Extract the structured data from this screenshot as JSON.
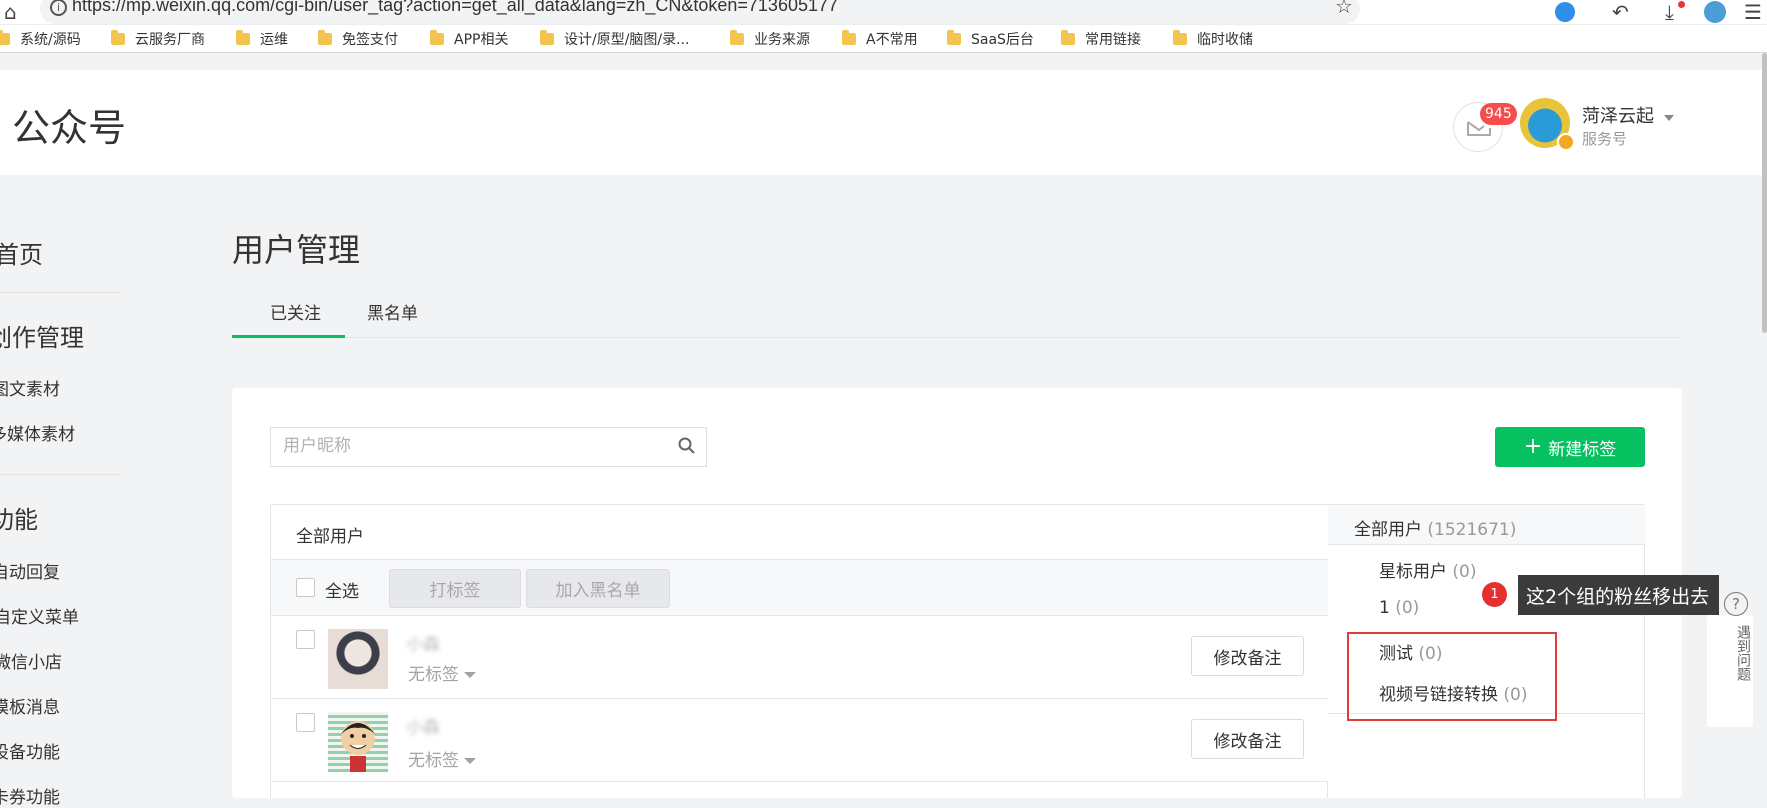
{
  "browser": {
    "url": "https://mp.weixin.qq.com/cgi-bin/user_tag?action=get_all_data&lang=zh_CN&token=713605177",
    "bookmarks": [
      "系统/源码",
      "云服务厂商",
      "运维",
      "免签支付",
      "APP相关",
      "设计/原型/脑图/录...",
      "业务来源",
      "A不常用",
      "SaaS后台",
      "常用链接",
      "临时收储"
    ]
  },
  "header": {
    "logo_text": "公众号",
    "mail_badge": "945",
    "account_name": "菏泽云起",
    "account_type": "服务号"
  },
  "sidebar": {
    "home": "首页",
    "section_create": "创作管理",
    "item_article": "图文素材",
    "item_media": "多媒体素材",
    "section_feature": "功能",
    "item_autoreply": "自动回复",
    "item_menu": "自定义菜单",
    "item_shop": "微信小店",
    "item_template": "模板消息",
    "item_device": "设备功能",
    "item_more": "卡券功能"
  },
  "main": {
    "title": "用户管理",
    "tabs": [
      "已关注",
      "黑名单"
    ]
  },
  "search": {
    "placeholder": "用户昵称"
  },
  "new_tag_label": "新建标签",
  "table": {
    "head_label": "全部用户",
    "select_all": "全选",
    "tag_button": "打标签",
    "blacklist_button": "加入黑名单",
    "rows": [
      {
        "name": "小森",
        "tag": "无标签",
        "remark": "修改备注"
      },
      {
        "name": "小森",
        "tag": "无标签",
        "remark": "修改备注"
      }
    ]
  },
  "tag_panel": {
    "all_label": "全部用户",
    "all_count": "(1521671)",
    "items": [
      {
        "label": "星标用户",
        "count": "(0)"
      },
      {
        "label": "1",
        "count": "(0)"
      },
      {
        "label": "测试",
        "count": "(0)"
      },
      {
        "label": "视频号链接转换",
        "count": "(0)"
      }
    ]
  },
  "annotation": {
    "marker": "1",
    "text": "这2个组的粉丝移出去"
  },
  "help": {
    "symbol": "?",
    "label": "遇到问题"
  },
  "colors": {
    "accent": "#07c160",
    "badge": "#f64c4c",
    "annotation": "#e03c3c"
  }
}
